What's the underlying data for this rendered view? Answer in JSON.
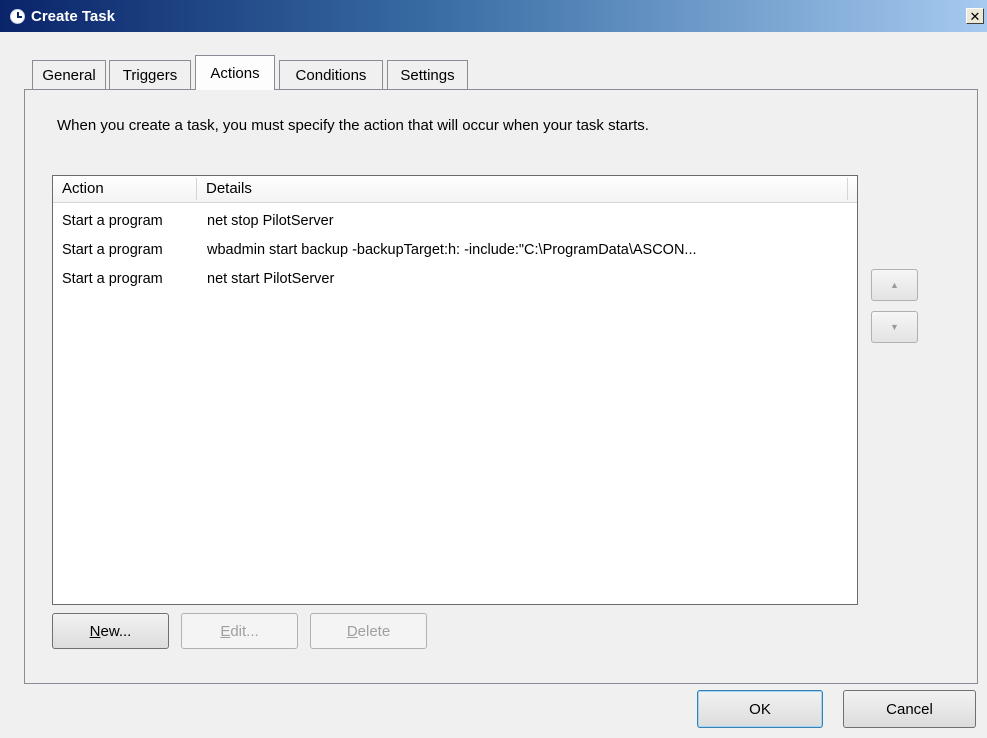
{
  "window": {
    "title": "Create Task",
    "close_label": "✕"
  },
  "tabs": [
    {
      "label": "General"
    },
    {
      "label": "Triggers"
    },
    {
      "label": "Actions"
    },
    {
      "label": "Conditions"
    },
    {
      "label": "Settings"
    }
  ],
  "description": "When you create a task, you must specify the action that will occur when your task starts.",
  "table": {
    "columns": [
      "Action",
      "Details"
    ],
    "rows": [
      {
        "action": "Start a program",
        "details": "net stop PilotServer"
      },
      {
        "action": "Start a program",
        "details": "wbadmin start backup -backupTarget:h: -include:\"C:\\ProgramData\\ASCON..."
      },
      {
        "action": "Start a program",
        "details": "net start PilotServer"
      }
    ]
  },
  "buttons": {
    "new": {
      "mnemonic": "N",
      "rest": "ew..."
    },
    "edit": {
      "mnemonic": "E",
      "rest": "dit..."
    },
    "delete": {
      "mnemonic": "D",
      "rest": "elete"
    },
    "move_up": "▲",
    "move_down": "▼",
    "ok": "OK",
    "cancel": "Cancel"
  }
}
